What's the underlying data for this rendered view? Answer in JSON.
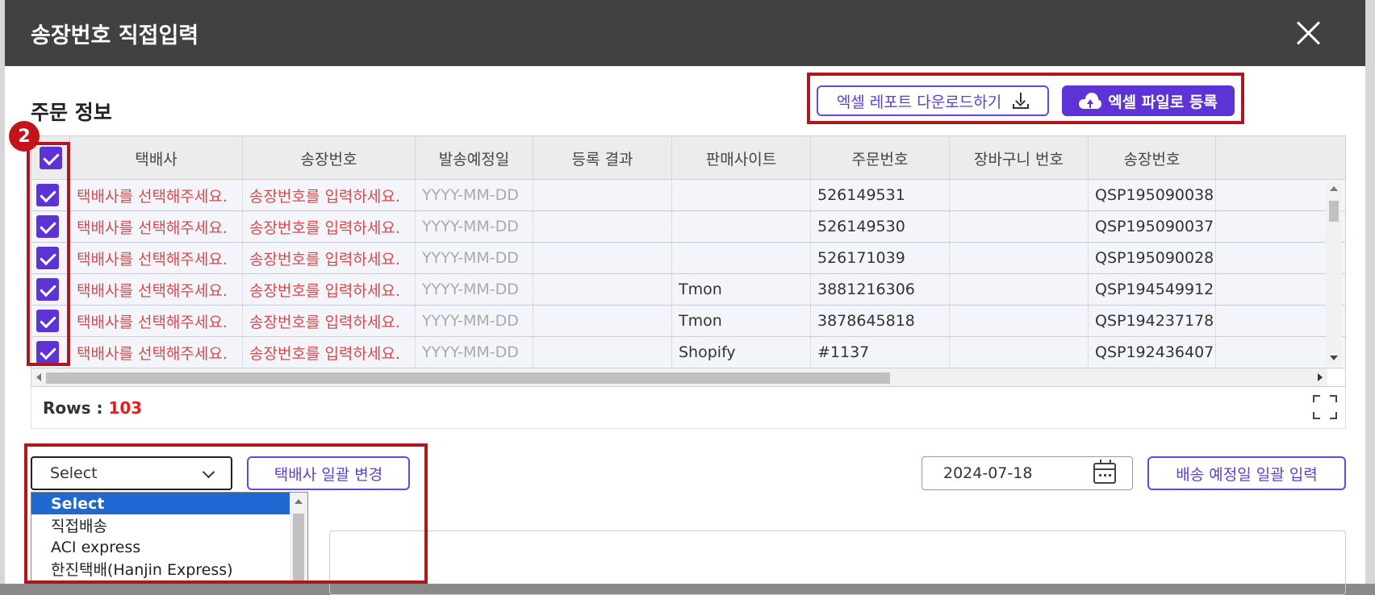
{
  "modal": {
    "title": "송장번호 직접입력"
  },
  "section": {
    "title": "주문 정보"
  },
  "buttons": {
    "download_report": "엑셀 레포트 다운로드하기",
    "upload_excel": "엑셀 파일로 등록",
    "bulk_carrier": "택배사 일괄 변경",
    "bulk_ship_date": "배송 예정일 일괄 입력"
  },
  "badge": "2",
  "table": {
    "headers": [
      "택배사",
      "송장번호",
      "발송예정일",
      "등록 결과",
      "판매사이트",
      "주문번호",
      "장바구니 번호",
      "송장번호"
    ],
    "rows": [
      {
        "carrier": "택배사를 선택해주세요.",
        "invoice": "송장번호를 입력하세요.",
        "ship_date": "YYYY-MM-DD",
        "result": "",
        "site": "",
        "order_no": "526149531",
        "cart_no": "",
        "invoice2": "QSP195090038"
      },
      {
        "carrier": "택배사를 선택해주세요.",
        "invoice": "송장번호를 입력하세요.",
        "ship_date": "YYYY-MM-DD",
        "result": "",
        "site": "",
        "order_no": "526149530",
        "cart_no": "",
        "invoice2": "QSP195090037"
      },
      {
        "carrier": "택배사를 선택해주세요.",
        "invoice": "송장번호를 입력하세요.",
        "ship_date": "YYYY-MM-DD",
        "result": "",
        "site": "",
        "order_no": "526171039",
        "cart_no": "",
        "invoice2": "QSP195090028"
      },
      {
        "carrier": "택배사를 선택해주세요.",
        "invoice": "송장번호를 입력하세요.",
        "ship_date": "YYYY-MM-DD",
        "result": "",
        "site": "Tmon",
        "order_no": "3881216306",
        "cart_no": "",
        "invoice2": "QSP194549912"
      },
      {
        "carrier": "택배사를 선택해주세요.",
        "invoice": "송장번호를 입력하세요.",
        "ship_date": "YYYY-MM-DD",
        "result": "",
        "site": "Tmon",
        "order_no": "3878645818",
        "cart_no": "",
        "invoice2": "QSP194237178"
      },
      {
        "carrier": "택배사를 선택해주세요.",
        "invoice": "송장번호를 입력하세요.",
        "ship_date": "YYYY-MM-DD",
        "result": "",
        "site": "Shopify",
        "order_no": "#1137",
        "cart_no": "",
        "invoice2": "QSP192436407"
      }
    ]
  },
  "rows_bar": {
    "label": "Rows : ",
    "count": "103"
  },
  "carrier_select": {
    "value": "Select",
    "options": [
      "Select",
      "직접배송",
      "ACI express",
      "한진택배(Hanjin Express)"
    ]
  },
  "date_input": {
    "value": "2024-07-18"
  },
  "colors": {
    "accent": "#5d33d6",
    "highlight_box": "#b0161d",
    "placeholder_red": "#d84a4a",
    "row_count": "#e02020"
  }
}
